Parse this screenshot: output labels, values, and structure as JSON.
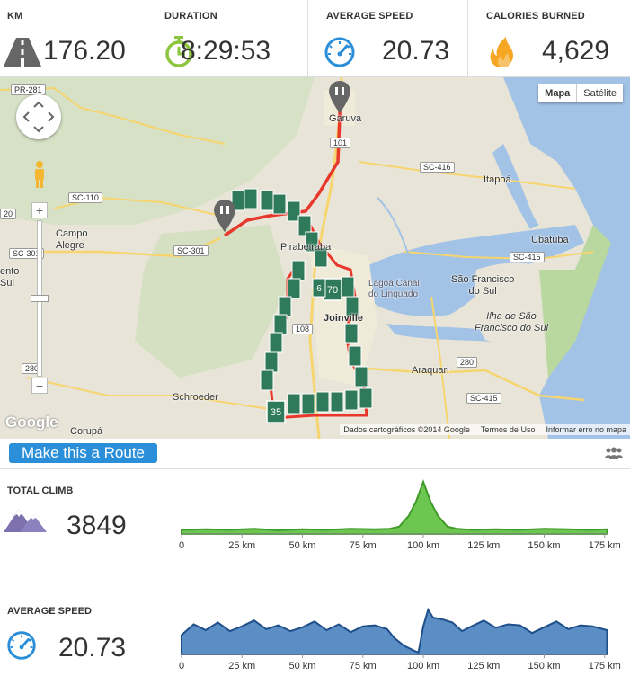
{
  "stats": {
    "km": {
      "label": "KM",
      "value": "176.20",
      "icon": "road-icon"
    },
    "duration": {
      "label": "DURATION",
      "value": "8:29:53",
      "icon": "stopwatch-icon"
    },
    "avg_speed": {
      "label": "AVERAGE SPEED",
      "value": "20.73",
      "icon": "speedometer-icon"
    },
    "calories": {
      "label": "CALORIES BURNED",
      "value": "4,629",
      "icon": "flame-icon"
    }
  },
  "map": {
    "type_buttons": [
      "Mapa",
      "Satélite"
    ],
    "active_type": "Mapa",
    "attribution": [
      "Dados cartográficos ©2014 Google",
      "Termos de Uso",
      "Informar erro no mapa"
    ],
    "logo": "Google",
    "places": [
      {
        "name": "Garuva"
      },
      {
        "name": "Itapoá"
      },
      {
        "name": "Campo\nAlegre"
      },
      {
        "name": "Pirabeiraba"
      },
      {
        "name": "Joinville"
      },
      {
        "name": "Lagoa Canal\ndo Linguado"
      },
      {
        "name": "São Francisco\ndo Sul"
      },
      {
        "name": "Ilha de São\nFrancisco do Sul"
      },
      {
        "name": "Ubatuba"
      },
      {
        "name": "Schroeder"
      },
      {
        "name": "Corupá"
      },
      {
        "name": "Araquari"
      },
      {
        "name": "ento\nSul"
      }
    ],
    "road_signs": [
      "PR-281",
      "SC-416",
      "SC-110",
      "101",
      "SC-301",
      "SC-301",
      "SC-415",
      "SC-415",
      "280",
      "280",
      "20",
      "108"
    ],
    "markers": [
      "70",
      "35",
      "6"
    ],
    "accent_route": "#e8382b",
    "marker_color": "#2f7a5a"
  },
  "route_button": {
    "label": "Make this a Route",
    "color": "#2a8ed8"
  },
  "total_climb": {
    "label": "TOTAL CLIMB",
    "value": "3849",
    "icon": "mountain-icon"
  },
  "avg_speed_panel": {
    "label": "AVERAGE SPEED",
    "value": "20.73",
    "icon": "speedometer-icon"
  },
  "chart_data": [
    {
      "type": "area",
      "title": "",
      "xlabel": "",
      "ylabel": "",
      "x_ticks": [
        "0",
        "25 km",
        "50 km",
        "75 km",
        "100 km",
        "125 km",
        "150 km",
        "175 km"
      ],
      "xlim": [
        0,
        176.2
      ],
      "color": "#3f9a2a",
      "fill": "#6cc64f",
      "series": [
        {
          "x": [
            0,
            10,
            20,
            30,
            40,
            50,
            60,
            70,
            80,
            86,
            90,
            94,
            97,
            100,
            103,
            106,
            110,
            114,
            120,
            130,
            140,
            150,
            160,
            170,
            176
          ],
          "y": [
            8,
            9,
            8,
            10,
            7,
            9,
            8,
            10,
            9,
            10,
            14,
            35,
            62,
            100,
            62,
            35,
            14,
            10,
            8,
            9,
            8,
            10,
            9,
            8,
            9
          ]
        }
      ]
    },
    {
      "type": "area",
      "title": "",
      "xlabel": "",
      "ylabel": "",
      "x_ticks": [
        "0",
        "25 km",
        "50 km",
        "75 km",
        "100 km",
        "125 km",
        "150 km",
        "175 km"
      ],
      "xlim": [
        0,
        176.2
      ],
      "color": "#1e4f8a",
      "fill": "#5a8ec4",
      "series": [
        {
          "x": [
            0,
            5,
            10,
            15,
            20,
            25,
            30,
            35,
            40,
            45,
            50,
            55,
            60,
            65,
            70,
            75,
            80,
            85,
            88,
            92,
            96,
            98,
            100,
            102,
            104,
            108,
            112,
            116,
            120,
            125,
            130,
            135,
            140,
            145,
            150,
            155,
            160,
            165,
            170,
            176
          ],
          "y": [
            40,
            62,
            50,
            66,
            48,
            58,
            70,
            52,
            60,
            48,
            56,
            68,
            50,
            62,
            46,
            58,
            60,
            52,
            34,
            18,
            8,
            4,
            58,
            92,
            76,
            72,
            66,
            48,
            58,
            70,
            55,
            62,
            60,
            44,
            56,
            68,
            52,
            60,
            58,
            50
          ]
        }
      ]
    }
  ]
}
